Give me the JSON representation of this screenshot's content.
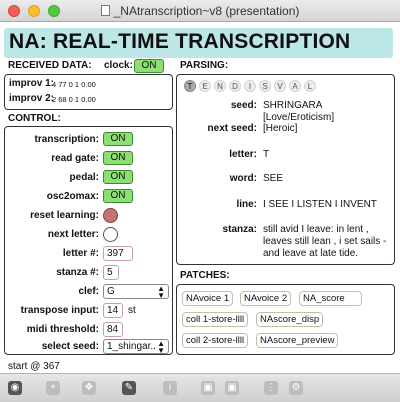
{
  "window": {
    "title": "_NAtranscription~v8 (presentation)"
  },
  "banner": {
    "title": "NA: REAL-TIME TRANSCRIPTION"
  },
  "received": {
    "label": "RECEIVED DATA:",
    "clock_label": "clock:",
    "clock_state": "ON",
    "rows": [
      {
        "label": "improv 1:",
        "value": "4 77 0 1 0.00"
      },
      {
        "label": "improv 2:",
        "value": "2 68 0 1 0.00"
      }
    ]
  },
  "control": {
    "label": "CONTROL:",
    "transcription": {
      "label": "transcription:",
      "state": "ON"
    },
    "read_gate": {
      "label": "read gate:",
      "state": "ON"
    },
    "pedal": {
      "label": "pedal:",
      "state": "ON"
    },
    "osc2omax": {
      "label": "osc2omax:",
      "state": "ON"
    },
    "reset_learning": {
      "label": "reset learning:"
    },
    "next_letter": {
      "label": "next letter:"
    },
    "letter_num": {
      "label": "letter #:",
      "value": "397"
    },
    "stanza_num": {
      "label": "stanza #:",
      "value": "5"
    },
    "clef": {
      "label": "clef:",
      "value": "G"
    },
    "transpose": {
      "label": "transpose input:",
      "value": "14",
      "unit": "st"
    },
    "midi_threshold": {
      "label": "midi threshold:",
      "value": "84"
    },
    "select_seed": {
      "label": "select seed:",
      "value": "1_shingar.."
    }
  },
  "parsing": {
    "label": "PARSING:",
    "letters": [
      "T",
      "E",
      "N",
      "D",
      "I",
      "S",
      "V",
      "A",
      "L"
    ],
    "active_letter_index": 0,
    "seed": {
      "label": "seed:",
      "value": "SHRINGARA [Love/Eroticism]"
    },
    "next_seed": {
      "label": "next seed:",
      "value": "[Heroic]"
    },
    "letter": {
      "label": "letter:",
      "value": "T"
    },
    "word": {
      "label": "word:",
      "value": "SEE"
    },
    "line": {
      "label": "line:",
      "value": "I SEE I LISTEN I INVENT"
    },
    "stanza": {
      "label": "stanza:",
      "value": "still avid I leave: in lent , leaves still lean , i set sails - and leave at late tide."
    }
  },
  "patches": {
    "label": "PATCHES:",
    "items": [
      "NAvoice 1",
      "NAvoice 2",
      "NA_score",
      "coll 1-store-llll",
      "NAscore_disp",
      "coll 2-store-llll",
      "NAscore_preview"
    ]
  },
  "status": {
    "text": "start @ 367"
  },
  "colors": {
    "banner": "#bde7e6",
    "toggle_on": "#8ddf75",
    "reset_dot": "#c77272"
  }
}
